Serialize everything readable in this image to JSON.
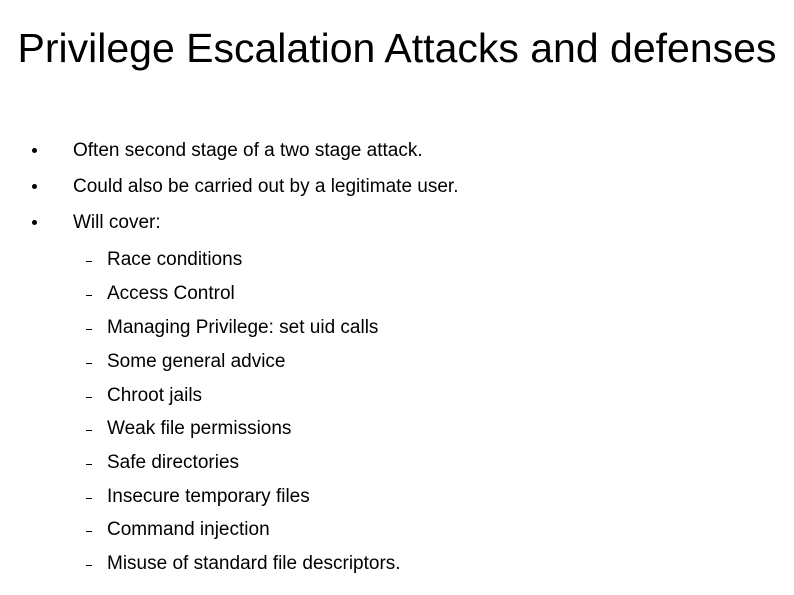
{
  "slide": {
    "title": "Privilege Escalation Attacks and defenses",
    "bullets": [
      "Often second stage of a two stage attack.",
      "Could also be carried out by a legitimate user.",
      "Will cover:"
    ],
    "sub_bullets": [
      "Race conditions",
      "Access Control",
      "Managing Privilege: set uid calls",
      "Some general advice",
      "Chroot jails",
      "Weak file permissions",
      "Safe directories",
      "Insecure temporary files",
      "Command injection",
      "Misuse of standard file descriptors."
    ]
  }
}
